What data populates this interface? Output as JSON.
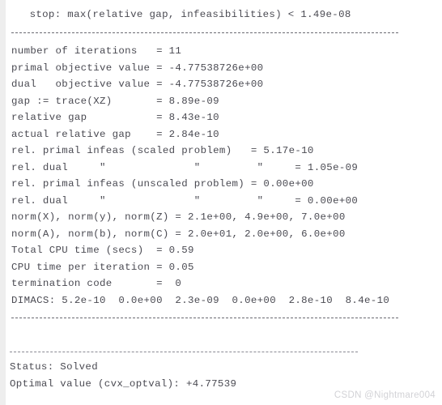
{
  "colors": {
    "background": "#ffffff",
    "gutter": "#eeeeee",
    "text": "#4a4a52",
    "rule": "#6b6b73",
    "watermark": "#d2d2d6"
  },
  "console": {
    "name": "sdpt3-cvx-solver-output",
    "stop_criterion": "  stop: max(relative gap, infeasibilities) < 1.49e-08",
    "rules": {
      "top": "--------------------------------------------------------------------",
      "middle": "--------------------------------------------------------------------",
      "bottom": "------------------------------------------------------------"
    },
    "summary_lines": [
      "number of iterations   = 11",
      "primal objective value = -4.77538726e+00",
      "dual   objective value = -4.77538726e+00",
      "gap := trace(XZ)       = 8.89e-09",
      "relative gap           = 8.43e-10",
      "actual relative gap    = 2.84e-10",
      "rel. primal infeas (scaled problem)   = 5.17e-10",
      "rel. dual     \"              \"         \"     = 1.05e-09",
      "rel. primal infeas (unscaled problem) = 0.00e+00",
      "rel. dual     \"              \"         \"     = 0.00e+00",
      "norm(X), norm(y), norm(Z) = 2.1e+00, 4.9e+00, 7.0e+00",
      "norm(A), norm(b), norm(C) = 2.0e+01, 2.0e+00, 6.0e+00",
      "Total CPU time (secs)  = 0.59",
      "CPU time per iteration = 0.05",
      "termination code       =  0",
      "DIMACS: 5.2e-10  0.0e+00  2.3e-09  0.0e+00  2.8e-10  8.4e-10"
    ],
    "status_label": "Status: Solved",
    "optimal_value_label": "Optimal value (cvx_optval): +4.77539",
    "fields": {
      "number_of_iterations": "11",
      "primal_objective_value": "-4.77538726e+00",
      "dual_objective_value": "-4.77538726e+00",
      "gap_trace_XZ": "8.89e-09",
      "relative_gap": "8.43e-10",
      "actual_relative_gap": "2.84e-10",
      "rel_primal_infeas_scaled": "5.17e-10",
      "rel_dual_infeas_scaled": "1.05e-09",
      "rel_primal_infeas_unscaled": "0.00e+00",
      "rel_dual_infeas_unscaled": "0.00e+00",
      "norm_X": "2.1e+00",
      "norm_y": "4.9e+00",
      "norm_Z": "7.0e+00",
      "norm_A": "2.0e+01",
      "norm_b": "2.0e+00",
      "norm_C": "6.0e+00",
      "total_cpu_time_secs": "0.59",
      "cpu_time_per_iteration": "0.05",
      "termination_code": "0",
      "dimacs_errors": [
        "5.2e-10",
        "0.0e+00",
        "2.3e-09",
        "0.0e+00",
        "2.8e-10",
        "8.4e-10"
      ],
      "stop_tolerance": "1.49e-08",
      "status": "Solved",
      "cvx_optval": "+4.77539"
    }
  },
  "watermark": {
    "text": "CSDN @Nightmare004"
  }
}
